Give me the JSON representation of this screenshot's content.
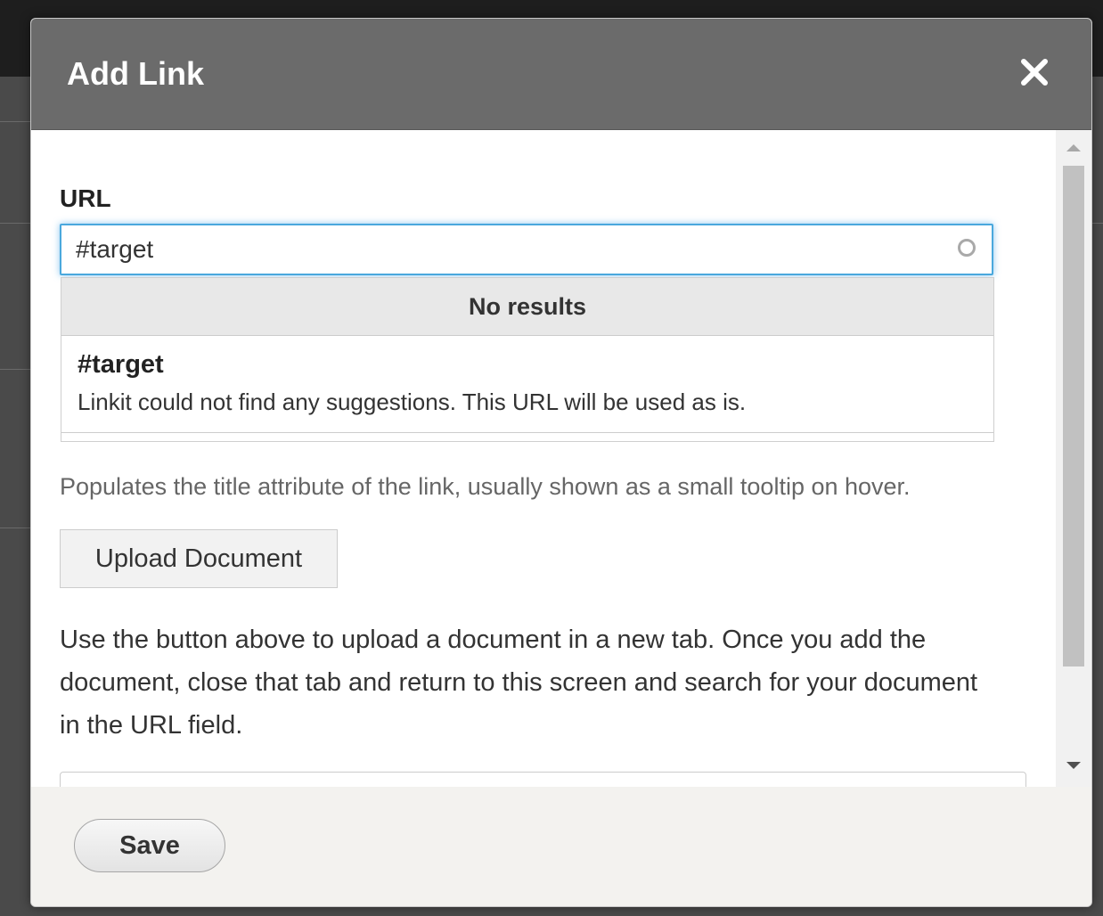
{
  "dialog": {
    "title": "Add Link",
    "close_icon": "close-icon"
  },
  "url_field": {
    "label": "URL",
    "value": "#target",
    "throbber_icon": "throbber-icon"
  },
  "autocomplete": {
    "header": "No results",
    "suggestion": {
      "title": "#target",
      "description": "Linkit could not find any suggestions. This URL will be used as is."
    }
  },
  "help_text": "Populates the title attribute of the link, usually shown as a small tooltip on hover.",
  "upload_button": {
    "label": "Upload Document"
  },
  "instructions": "Use the button above to upload a document in a new tab. Once you add the document, close that tab and return to this screen and search for your document in the URL field.",
  "footer": {
    "save_label": "Save"
  },
  "colors": {
    "header_bg": "#6b6b6b",
    "focus_ring": "#4aa8dd",
    "footer_bg": "#f3f2ef"
  }
}
